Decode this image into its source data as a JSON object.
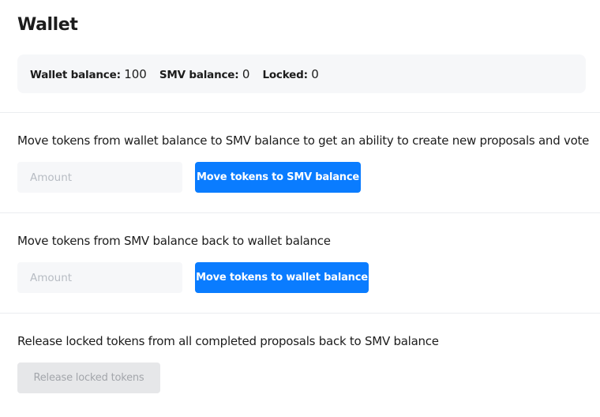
{
  "page": {
    "title": "Wallet"
  },
  "balances": {
    "wallet_label": "Wallet balance:",
    "wallet_value": "100",
    "smv_label": "SMV balance:",
    "smv_value": "0",
    "locked_label": "Locked:",
    "locked_value": "0"
  },
  "to_smv": {
    "description": "Move tokens from wallet balance to SMV balance to get an ability to create new proposals and vote",
    "input_placeholder": "Amount",
    "input_value": "",
    "button_label": "Move tokens to SMV balance"
  },
  "to_wallet": {
    "description": "Move tokens from SMV balance back to wallet balance",
    "input_placeholder": "Amount",
    "input_value": "",
    "button_label": "Move tokens to wallet balance"
  },
  "release": {
    "description": "Release locked tokens from all completed proposals back to SMV balance",
    "button_label": "Release locked tokens",
    "button_disabled": true
  },
  "colors": {
    "primary": "#0a7cff",
    "disabled_bg": "#e6e7e9",
    "panel_bg": "#f6f7f9"
  }
}
